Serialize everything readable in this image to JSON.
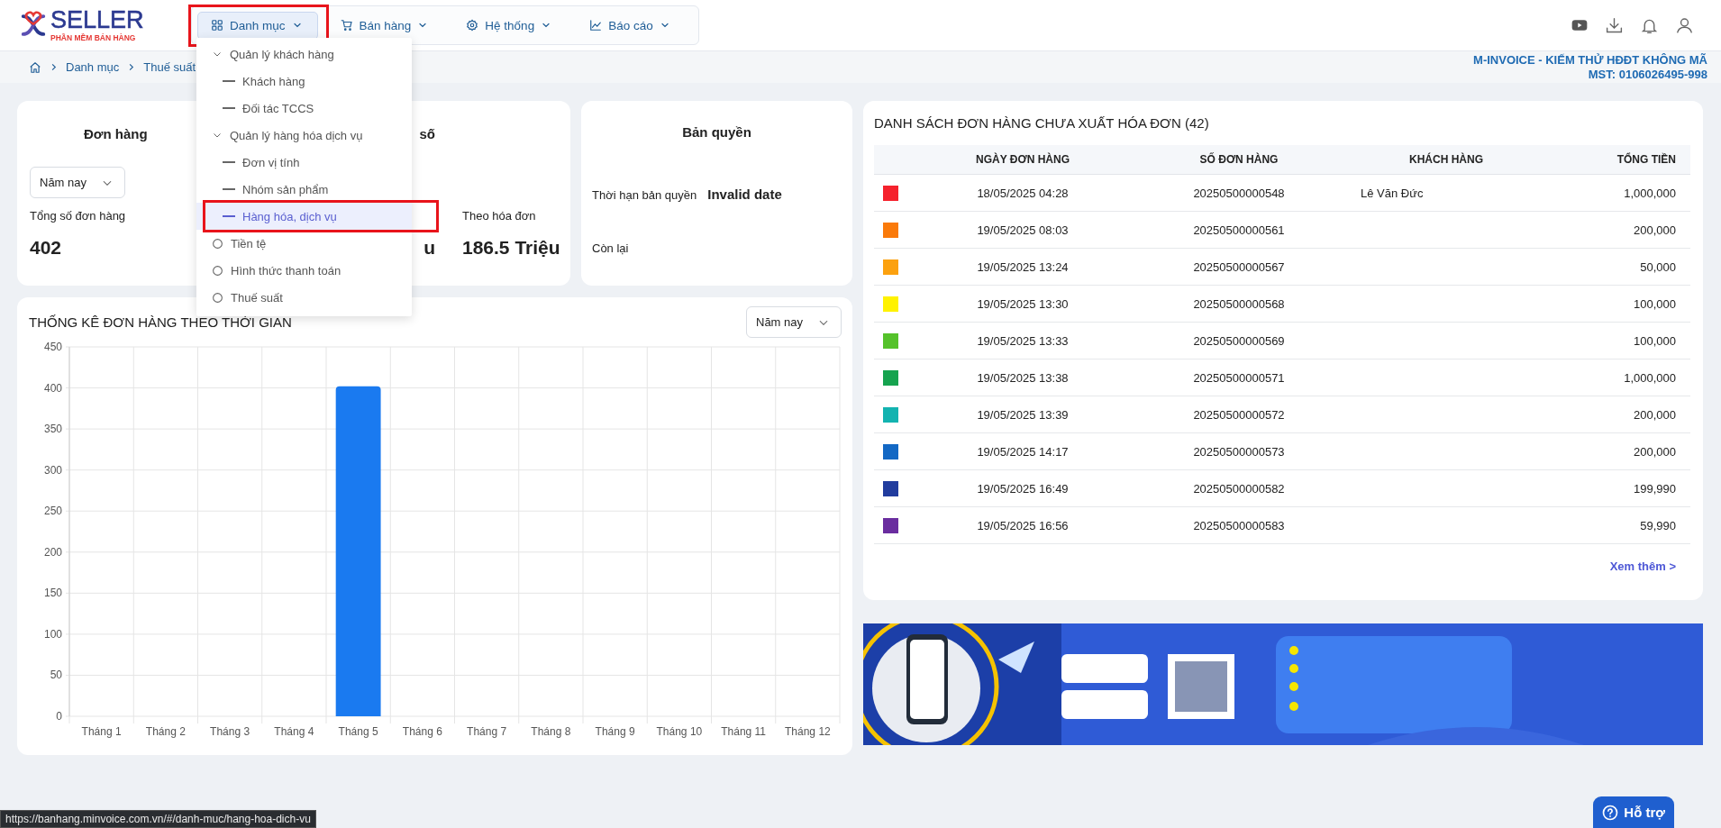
{
  "header": {
    "logo": {
      "name": "SELLER",
      "tagline": "PHẦN MỀM BÁN HÀNG"
    },
    "nav": [
      {
        "label": "Danh mục",
        "selected": true,
        "highlighted": true
      },
      {
        "label": "Bán hàng",
        "selected": false,
        "highlighted": false
      },
      {
        "label": "Hệ thống",
        "selected": false,
        "highlighted": false
      },
      {
        "label": "Báo cáo",
        "selected": false,
        "highlighted": false
      }
    ]
  },
  "breadcrumb": [
    "Danh mục",
    "Thuế suất"
  ],
  "company": {
    "name": "M-INVOICE - KIẾM THỬ HĐĐT KHÔNG MÃ",
    "tax_id": "MST: 0106026495-998"
  },
  "menu": [
    {
      "label": "Quản lý khách hàng",
      "expanded": true,
      "children": [
        {
          "label": "Khách hàng",
          "selected": false,
          "highlighted": false
        },
        {
          "label": "Đối tác TCCS",
          "selected": false,
          "highlighted": false
        }
      ]
    },
    {
      "label": "Quản lý hàng hóa dịch vụ",
      "expanded": true,
      "children": [
        {
          "label": "Đơn vị tính",
          "selected": false,
          "highlighted": false
        },
        {
          "label": "Nhóm sản phẩm",
          "selected": false,
          "highlighted": false
        },
        {
          "label": "Hàng hóa, dịch vụ",
          "selected": true,
          "highlighted": true
        }
      ]
    },
    {
      "label": "Tiền tệ",
      "selected": false,
      "highlighted": false
    },
    {
      "label": "Hình thức thanh toán",
      "selected": false,
      "highlighted": false
    },
    {
      "label": "Thuế suất",
      "selected": false,
      "highlighted": false
    }
  ],
  "orders_card": {
    "title": "Đơn hàng",
    "period": "Năm nay",
    "total_label": "Tổng số đơn hàng",
    "total": "402",
    "revenue_title": "số",
    "revenue_value": "u",
    "invoice_label": "Theo hóa đơn",
    "invoice_value": "186.5 Triệu"
  },
  "license_card": {
    "title": "Bản quyền",
    "expiry_label": "Thời hạn bản quyền",
    "expiry_value": "Invalid date",
    "remaining_label": "Còn lại"
  },
  "chart_card": {
    "title": "THỐNG KÊ ĐƠN HÀNG THEO THỜI GIAN",
    "period": "Năm nay",
    "chart_data": {
      "type": "bar",
      "categories": [
        "Tháng 1",
        "Tháng 2",
        "Tháng 3",
        "Tháng 4",
        "Tháng 5",
        "Tháng 6",
        "Tháng 7",
        "Tháng 8",
        "Tháng 9",
        "Tháng 10",
        "Tháng 11",
        "Tháng 12"
      ],
      "series": [
        {
          "color": "#1a7af0",
          "values": [
            0,
            0,
            0,
            0,
            402,
            0,
            0,
            0,
            0,
            0,
            0,
            0
          ]
        }
      ],
      "grid": true,
      "ylim": [
        0,
        450
      ],
      "yticks": [
        0,
        50,
        100,
        150,
        200,
        250,
        300,
        350,
        400,
        450
      ]
    }
  },
  "orders_table": {
    "title": "DANH SÁCH ĐƠN HÀNG CHƯA XUẤT HÓA ĐƠN (42)",
    "columns": [
      "NGÀY ĐƠN HÀNG",
      "SỐ ĐƠN HÀNG",
      "KHÁCH HÀNG",
      "TỔNG TIỀN"
    ],
    "rows": [
      {
        "color": "#f5222d",
        "date": "18/05/2025 04:28",
        "number": "20250500000548",
        "customer": "Lê Văn Đức",
        "total": "1,000,000"
      },
      {
        "color": "#fa7a0a",
        "date": "19/05/2025 08:03",
        "number": "20250500000561",
        "total": "200,000"
      },
      {
        "color": "#fca10f",
        "date": "19/05/2025 13:24",
        "number": "20250500000567",
        "total": "50,000"
      },
      {
        "color": "#fff200",
        "date": "19/05/2025 13:30",
        "number": "20250500000568",
        "total": "100,000"
      },
      {
        "color": "#55c22b",
        "date": "19/05/2025 13:33",
        "number": "20250500000569",
        "total": "100,000"
      },
      {
        "color": "#16a34f",
        "date": "19/05/2025 13:38",
        "number": "20250500000571",
        "total": "1,000,000"
      },
      {
        "color": "#13b3b0",
        "date": "19/05/2025 13:39",
        "number": "20250500000572",
        "total": "200,000"
      },
      {
        "color": "#1368c4",
        "date": "19/05/2025 14:17",
        "number": "20250500000573",
        "total": "200,000"
      },
      {
        "color": "#213c9e",
        "date": "19/05/2025 16:49",
        "number": "20250500000582",
        "total": "199,990"
      },
      {
        "color": "#6a2d9f",
        "date": "19/05/2025 16:56",
        "number": "20250500000583",
        "total": "59,990"
      }
    ],
    "more_link": "Xem thêm >"
  },
  "banner": {
    "kind": "picture"
  },
  "help_button": "Hỗ trợ",
  "status_url": "https://banhang.minvoice.com.vn/#/danh-muc/hang-hoa-dich-vu"
}
